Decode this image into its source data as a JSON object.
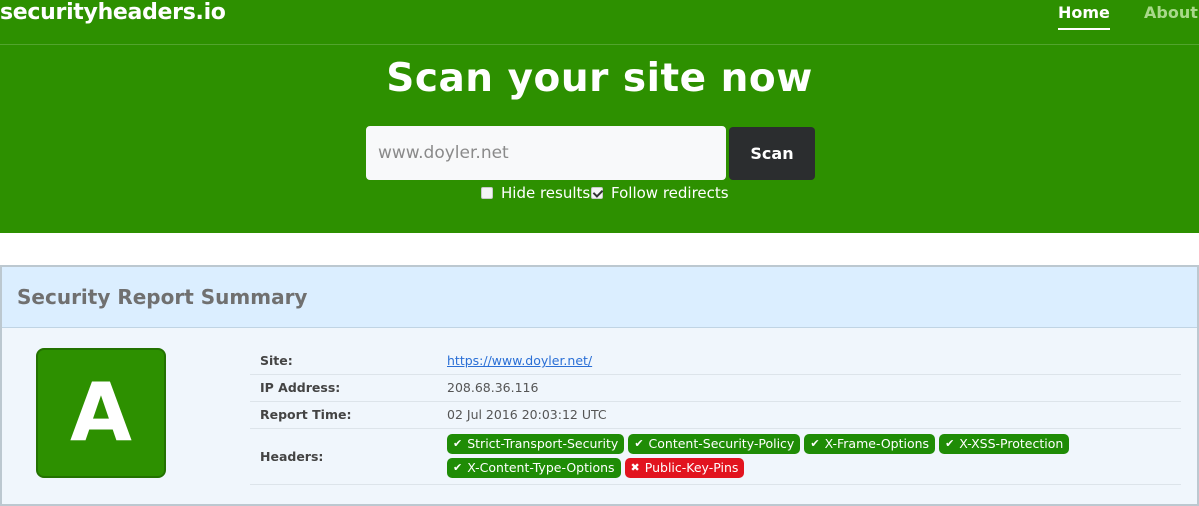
{
  "nav": {
    "brand": "securityheaders.io",
    "home": "Home",
    "about": "About"
  },
  "hero": {
    "title": "Scan your site now",
    "search_value": "www.doyler.net",
    "scan_label": "Scan",
    "hide_results_label": "Hide results",
    "hide_results_checked": false,
    "follow_redirects_label": "Follow redirects",
    "follow_redirects_checked": true
  },
  "report": {
    "title": "Security Report Summary",
    "grade": "A",
    "rows": {
      "site_label": "Site:",
      "site_value": "https://www.doyler.net/",
      "ip_label": "IP Address:",
      "ip_value": "208.68.36.116",
      "time_label": "Report Time:",
      "time_value": "02 Jul 2016 20:03:12 UTC",
      "headers_label": "Headers:"
    },
    "headers": [
      {
        "name": "Strict-Transport-Security",
        "status": "present",
        "icon": "check-icon"
      },
      {
        "name": "Content-Security-Policy",
        "status": "present",
        "icon": "check-icon"
      },
      {
        "name": "X-Frame-Options",
        "status": "present",
        "icon": "check-icon"
      },
      {
        "name": "X-XSS-Protection",
        "status": "present",
        "icon": "check-icon"
      },
      {
        "name": "X-Content-Type-Options",
        "status": "present",
        "icon": "check-icon"
      },
      {
        "name": "Public-Key-Pins",
        "status": "missing",
        "icon": "cross-icon"
      }
    ]
  },
  "colors": {
    "brand_green": "#2d9000",
    "badge_green": "#1f8c06",
    "badge_red": "#e2141f",
    "scan_button": "#2b2d2f",
    "panel_heading": "#dbeeff"
  }
}
